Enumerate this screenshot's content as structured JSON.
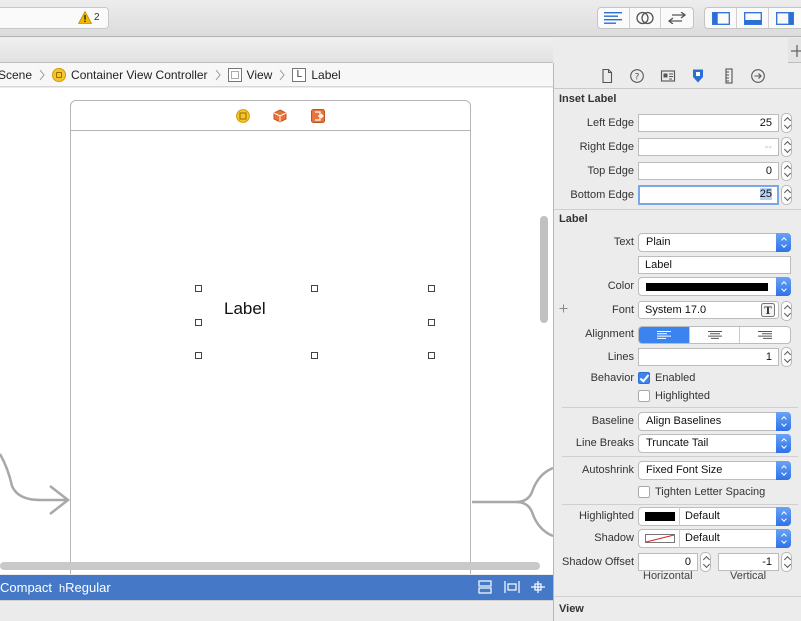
{
  "toolbar": {
    "warning_count": "2",
    "editor_buttons": [
      "standard-editor",
      "assistant-editor",
      "version-editor"
    ],
    "panel_buttons": [
      "navigator-panel",
      "debug-panel",
      "utilities-panel"
    ]
  },
  "breadcrumb": {
    "scene": "Scene",
    "controller": "Container View Controller",
    "view": "View",
    "label": "Label",
    "label_icon_letter": "L"
  },
  "canvas": {
    "label_text": "Label"
  },
  "size_class": {
    "width_text": "Compact",
    "height_prefix": "h",
    "height_text": "Regular"
  },
  "inspector": {
    "inset_section": {
      "title": "Inset Label",
      "left_edge_label": "Left Edge",
      "left_edge_value": "25",
      "right_edge_label": "Right Edge",
      "right_edge_placeholder": "--",
      "top_edge_label": "Top Edge",
      "top_edge_value": "0",
      "bottom_edge_label": "Bottom Edge",
      "bottom_edge_value": "25"
    },
    "label_section": {
      "title": "Label",
      "text_label": "Text",
      "text_type": "Plain",
      "text_value": "Label",
      "color_label": "Color",
      "font_label": "Font",
      "font_value": "System 17.0",
      "alignment_label": "Alignment",
      "lines_label": "Lines",
      "lines_value": "1",
      "behavior_label": "Behavior",
      "enabled_label": "Enabled",
      "enabled_checked": true,
      "highlighted_check_label": "Highlighted",
      "highlighted_checked": false,
      "baseline_label": "Baseline",
      "baseline_value": "Align Baselines",
      "line_breaks_label": "Line Breaks",
      "line_breaks_value": "Truncate Tail",
      "autoshrink_label": "Autoshrink",
      "autoshrink_value": "Fixed Font Size",
      "tighten_label": "Tighten Letter Spacing",
      "tighten_checked": false,
      "highlighted_label": "Highlighted",
      "highlighted_color": "Default",
      "shadow_label": "Shadow",
      "shadow_color": "Default",
      "shadow_offset_label": "Shadow Offset",
      "shadow_offset_h": "0",
      "shadow_offset_v": "-1",
      "horizontal_caption": "Horizontal",
      "vertical_caption": "Vertical"
    },
    "view_section": {
      "title": "View"
    }
  },
  "colors": {
    "accent": "#3b84f0",
    "size_bar": "#4578c6",
    "text_color": "#000000"
  }
}
